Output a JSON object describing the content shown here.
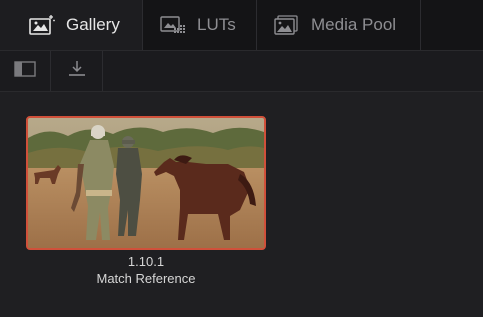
{
  "tabs": [
    {
      "label": "Gallery",
      "icon": "gallery-icon",
      "active": true
    },
    {
      "label": "LUTs",
      "icon": "luts-icon",
      "active": false
    },
    {
      "label": "Media Pool",
      "icon": "media-pool-icon",
      "active": false
    }
  ],
  "toolbar": {
    "buttons": [
      {
        "icon": "sidebar-toggle-icon"
      },
      {
        "icon": "download-icon"
      }
    ]
  },
  "gallery": {
    "stills": [
      {
        "id": "1.10.1",
        "label": "Match Reference",
        "selected": true
      }
    ]
  },
  "colors": {
    "selection_border": "#d0503a",
    "background": "#1f1f22"
  }
}
